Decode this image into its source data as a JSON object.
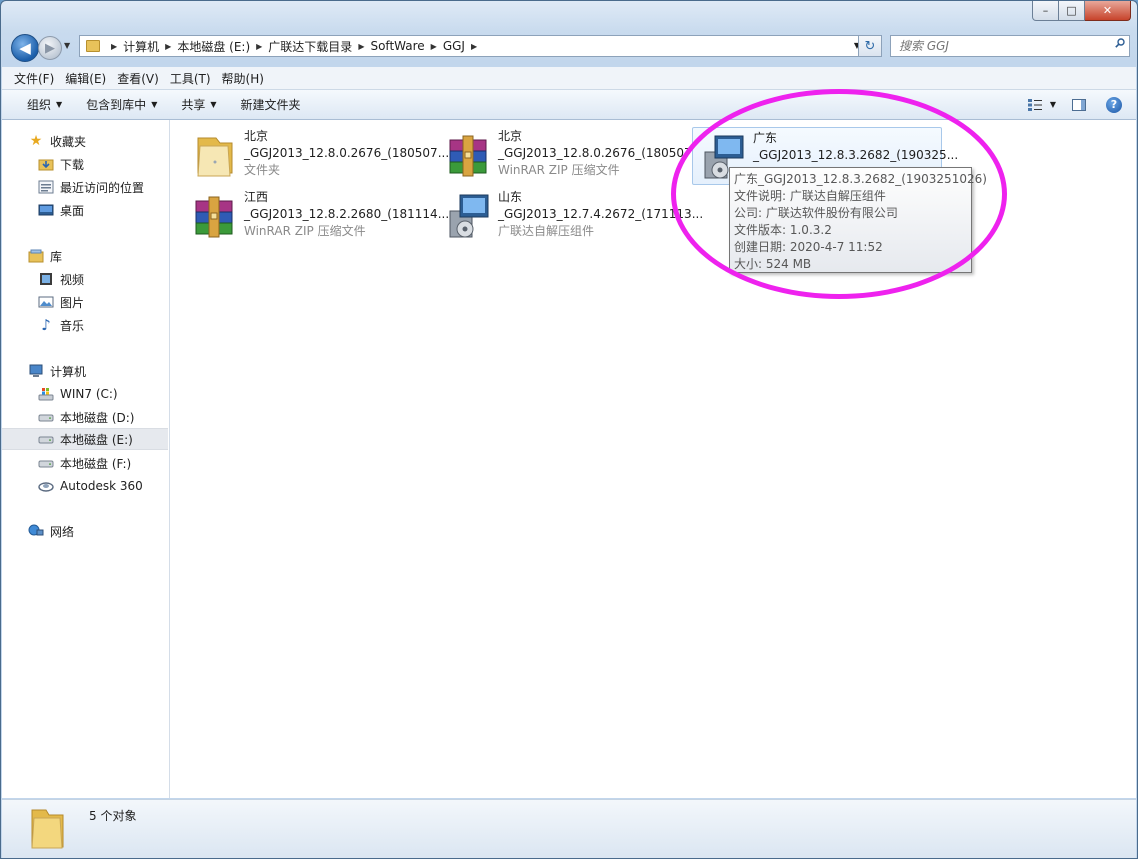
{
  "window": {
    "caption_buttons": {
      "minimize": "–",
      "maximize": "□",
      "close": "✕"
    }
  },
  "nav": {
    "breadcrumbs": [
      "计算机",
      "本地磁盘 (E:)",
      "广联达下载目录",
      "SoftWare",
      "GGJ"
    ],
    "search_placeholder": "搜索 GGJ"
  },
  "menu": [
    "文件(F)",
    "编辑(E)",
    "查看(V)",
    "工具(T)",
    "帮助(H)"
  ],
  "commands": {
    "organize": "组织",
    "include_in_library": "包含到库中",
    "share": "共享",
    "new_folder": "新建文件夹"
  },
  "sidebar": {
    "favorites": {
      "label": "收藏夹",
      "items": [
        "下载",
        "最近访问的位置",
        "桌面"
      ]
    },
    "libraries": {
      "label": "库",
      "items": [
        "视频",
        "图片",
        "音乐"
      ]
    },
    "computer": {
      "label": "计算机",
      "items": [
        "WIN7 (C:)",
        "本地磁盘 (D:)",
        "本地磁盘 (E:)",
        "本地磁盘 (F:)",
        "Autodesk 360"
      ],
      "selected": "本地磁盘 (E:)"
    },
    "network": {
      "label": "网络"
    }
  },
  "files": [
    {
      "name1": "北京",
      "name2": "_GGJ2013_12.8.0.2676_(180507...",
      "type": "文件夹",
      "icon": "folder-icon"
    },
    {
      "name1": "北京",
      "name2": "_GGJ2013_12.8.0.2676_(180507...",
      "type": "WinRAR ZIP 压缩文件",
      "icon": "winrar-archive-icon"
    },
    {
      "name1": "广东",
      "name2": "_GGJ2013_12.8.3.2682_(190325...",
      "type": "",
      "icon": "installer-icon"
    },
    {
      "name1": "江西",
      "name2": "_GGJ2013_12.8.2.2680_(181114...",
      "type": "WinRAR ZIP 压缩文件",
      "icon": "winrar-archive-icon"
    },
    {
      "name1": "山东",
      "name2": "_GGJ2013_12.7.4.2672_(171113...",
      "type": "广联达自解压组件",
      "icon": "installer-icon"
    }
  ],
  "tooltip": {
    "lines": [
      "广东_GGJ2013_12.8.3.2682_(1903251026)",
      "文件说明: 广联达自解压组件",
      "公司: 广联达软件股份有限公司",
      "文件版本: 1.0.3.2",
      "创建日期: 2020-4-7 11:52",
      "大小: 524 MB"
    ]
  },
  "status": {
    "count_text": "5 个对象"
  },
  "colors": {
    "annotation": "#ee22ee",
    "accent": "#1b5eaa"
  }
}
